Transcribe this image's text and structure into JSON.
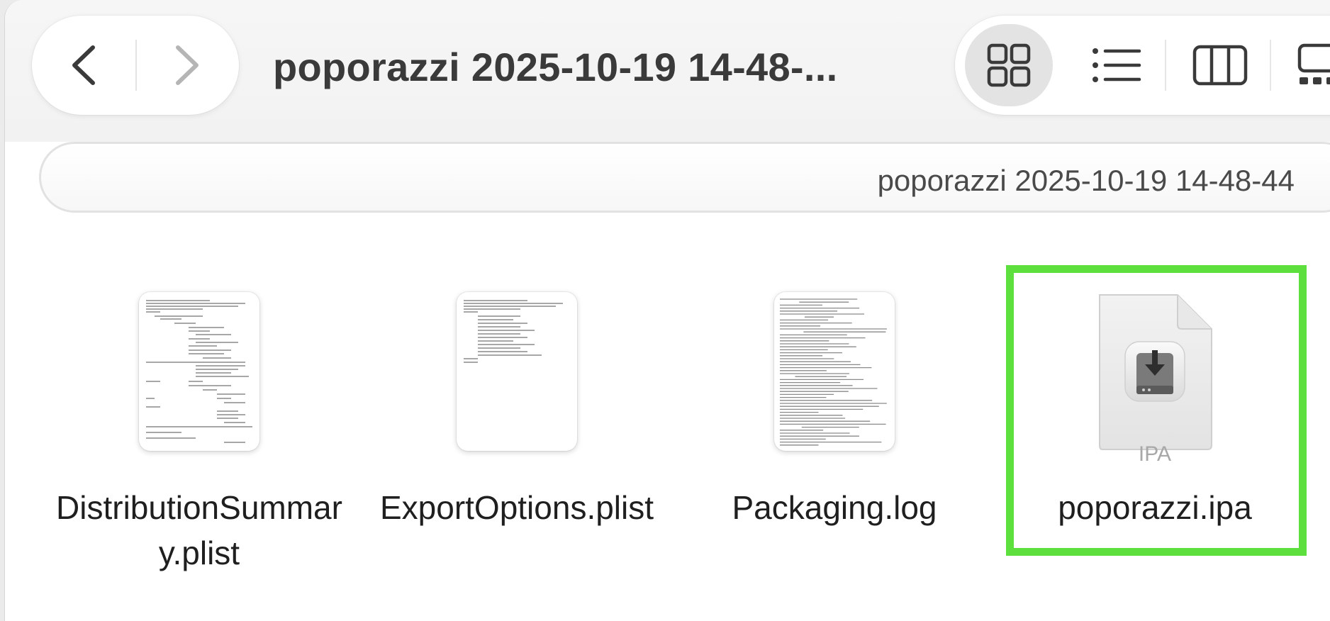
{
  "window": {
    "title": "poporazzi 2025-10-19 14-48-..."
  },
  "navigation": {
    "back_icon": "chevron-left-icon",
    "forward_icon": "chevron-right-icon"
  },
  "view_controls": {
    "items": [
      {
        "icon": "icon-view-icon",
        "active": true
      },
      {
        "icon": "list-view-icon",
        "active": false
      },
      {
        "icon": "column-view-icon",
        "active": false
      },
      {
        "icon": "gallery-view-icon",
        "active": false
      }
    ]
  },
  "path_bar": {
    "text": "poporazzi 2025-10-19 14-48-44"
  },
  "files": [
    {
      "name": "DistributionSummary.plist",
      "icon": "plist-document-icon",
      "selected": false
    },
    {
      "name": "ExportOptions.plist",
      "icon": "plist-document-icon",
      "selected": false
    },
    {
      "name": "Packaging.log",
      "icon": "log-document-icon",
      "selected": false
    },
    {
      "name": "poporazzi.ipa",
      "icon": "ipa-package-icon",
      "badge": "IPA",
      "selected": true
    }
  ],
  "colors": {
    "selection_highlight": "#5ddf3d",
    "active_view_bg": "#e3e3e3",
    "text": "#1f1f1f"
  }
}
